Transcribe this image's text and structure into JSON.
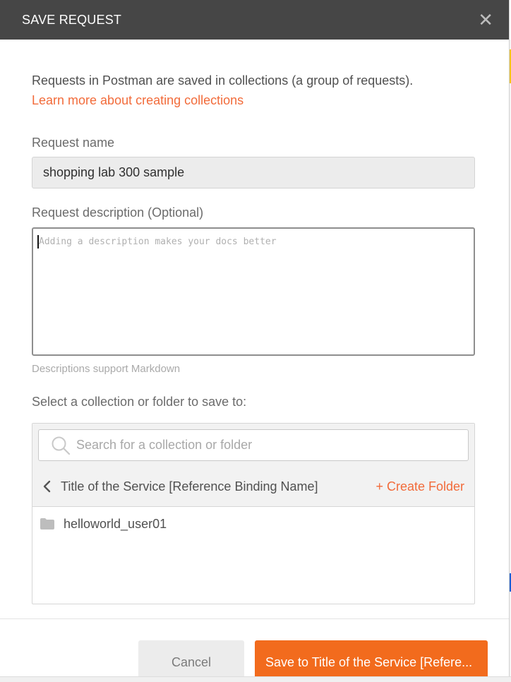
{
  "dialog": {
    "title": "SAVE REQUEST",
    "close_icon": "close-icon"
  },
  "intro": {
    "text": "Requests in Postman are saved in collections (a group of requests).",
    "link": "Learn more about creating collections"
  },
  "request_name": {
    "label": "Request name",
    "value": "shopping lab 300 sample"
  },
  "request_description": {
    "label": "Request description (Optional)",
    "placeholder": "Adding a description makes your docs better",
    "hint": "Descriptions support Markdown"
  },
  "collection": {
    "label": "Select a collection or folder to save to:",
    "search_placeholder": "Search for a collection or folder",
    "breadcrumb": "Title of the Service [Reference Binding Name]",
    "create_folder": "+ Create Folder",
    "items": [
      {
        "name": "helloworld_user01",
        "icon": "folder-icon"
      }
    ]
  },
  "footer": {
    "cancel": "Cancel",
    "save": "Save to Title of the Service [Refere..."
  },
  "colors": {
    "header_bg": "#464646",
    "accent": "#f26b1d",
    "link": "#f26b3a"
  }
}
